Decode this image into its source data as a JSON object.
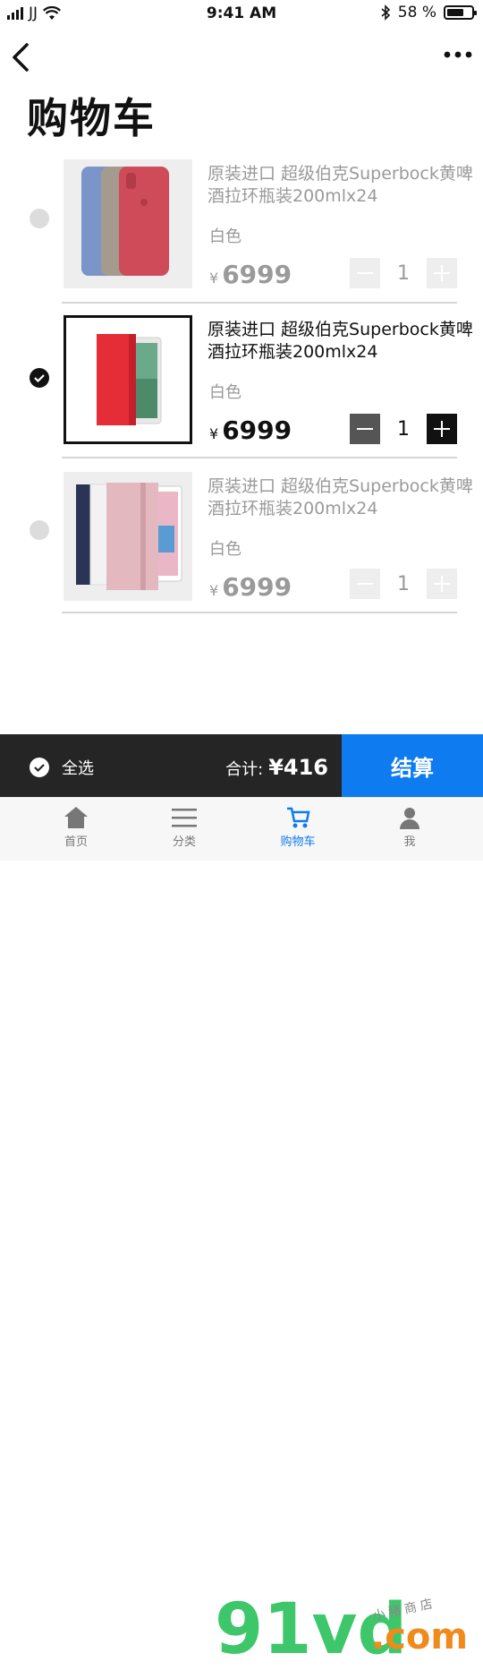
{
  "status_bar": {
    "carrier": "JJ",
    "time": "9:41 AM",
    "battery": "58 %",
    "battery_level": 0.58
  },
  "nav": {
    "back_icon": "chevron-left-icon",
    "more_icon": "ellipsis-icon"
  },
  "page": {
    "title": "购物车"
  },
  "items": [
    {
      "name": "原装进口 超级伯克Superbock黄啤酒拉环瓶装200mlx24",
      "color": "白色",
      "currency": "¥",
      "price": "6999",
      "quantity": "1",
      "selected": false,
      "product_image": "iphone-cases"
    },
    {
      "name": "原装进口 超级伯克Superbock黄啤酒拉环瓶装200mlx24",
      "color": "白色",
      "currency": "¥",
      "price": "6999",
      "quantity": "1",
      "selected": true,
      "product_image": "red-ipad-smart-cover"
    },
    {
      "name": "原装进口 超级伯克Superbock黄啤酒拉环瓶装200mlx24",
      "color": "白色",
      "currency": "¥",
      "price": "6999",
      "quantity": "1",
      "selected": false,
      "product_image": "ipad-smart-covers"
    }
  ],
  "checkout": {
    "select_all_label": "全选",
    "total_label": "合计:",
    "total_amount": "¥416",
    "pay_label": "结算",
    "pay_color": "#0e7bf0"
  },
  "tabbar": {
    "tabs": [
      {
        "label": "首页",
        "icon": "home-icon"
      },
      {
        "label": "分类",
        "icon": "menu-icon"
      },
      {
        "label": "购物车",
        "icon": "cart-icon",
        "active": true
      },
      {
        "label": "我",
        "icon": "user-icon"
      }
    ]
  },
  "watermark": {
    "text1": "91vd",
    "text2": ".com",
    "shop": "小猪商店"
  }
}
